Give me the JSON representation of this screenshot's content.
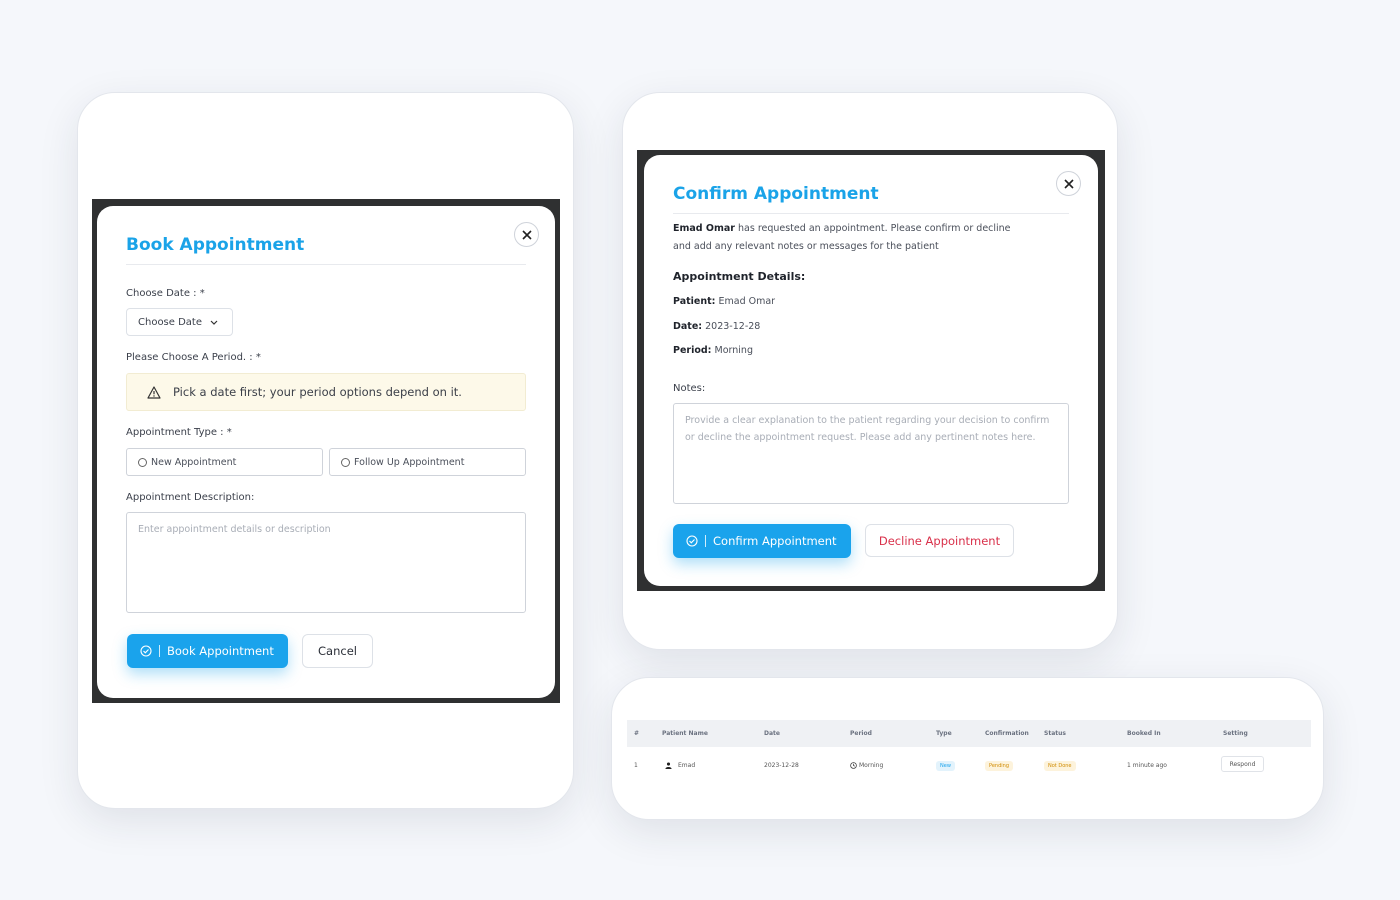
{
  "book": {
    "title": "Book Appointment",
    "date_label": "Choose Date : *",
    "date_button": "Choose Date",
    "period_label": "Please Choose A Period. : *",
    "period_alert": "Pick a date first; your period options depend on it.",
    "type_label": "Appointment Type : *",
    "type_options": [
      "New Appointment",
      "Follow Up Appointment"
    ],
    "description_label": "Appointment Description:",
    "description_placeholder": "Enter appointment details or description",
    "submit_label": "Book Appointment",
    "cancel_label": "Cancel"
  },
  "confirm": {
    "title": "Confirm Appointment",
    "requester": "Emad Omar",
    "intro_rest": " has requested an appointment. Please confirm or decline",
    "intro_line2": "and add any relevant notes or messages for the patient",
    "details_heading": "Appointment Details:",
    "details": [
      {
        "label": "Patient:",
        "value": "Emad Omar"
      },
      {
        "label": "Date:",
        "value": "2023-12-28"
      },
      {
        "label": "Period:",
        "value": "Morning"
      }
    ],
    "notes_label": "Notes:",
    "notes_placeholder": "Provide a clear explanation to the patient regarding your decision to confirm or decline the appointment request. Please add any pertinent notes here.",
    "confirm_label": "Confirm Appointment",
    "decline_label": "Decline Appointment"
  },
  "table": {
    "headers": [
      "#",
      "Patient Name",
      "Date",
      "Period",
      "Type",
      "Confirmation",
      "Status",
      "Booked In",
      "Setting"
    ],
    "rows": [
      {
        "index": "1",
        "patient": "Emad",
        "date": "2023-12-28",
        "period": "Morning",
        "type": "New",
        "confirmation": "Pending",
        "status": "Not Done",
        "booked_in": "1 minute ago",
        "setting": "Respond"
      }
    ]
  },
  "colors": {
    "accent": "#1aa3ec",
    "decline": "#d9304a",
    "alert_bg": "#fdf9e9",
    "overlay": "#2f3031"
  }
}
